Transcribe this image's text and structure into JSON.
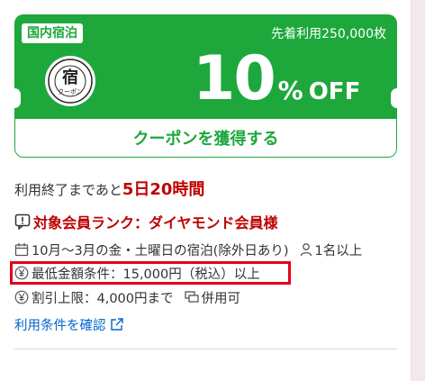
{
  "coupon": {
    "badge": "国内宿泊",
    "first_come": "先着利用250,000枚",
    "discount_number": "10",
    "discount_percent": "%",
    "discount_off": "OFF",
    "get_button": "クーポンを獲得する",
    "stamp_char": "宿",
    "stamp_sub": "クーポン",
    "colors": {
      "green": "#1ea83c",
      "red": "#bf0000",
      "highlight": "#e3001b"
    }
  },
  "remaining": {
    "prefix": "利用終了まであと",
    "time": "5日20時間"
  },
  "details": {
    "rank": "対象会員ランク：ダイヤモンド会員様",
    "period": "10月～3月の金・土曜日の宿泊(除外日あり)",
    "persons": "1名以上",
    "minimum": "最低金額条件：15,000円（税込）以上",
    "max_discount": "割引上限：4,000円まで",
    "combinable": "併用可",
    "terms_link": "利用条件を確認"
  },
  "icons": [
    "alert-icon",
    "calendar-icon",
    "person-icon",
    "yen-icon",
    "copy-icon",
    "external-link-icon"
  ]
}
